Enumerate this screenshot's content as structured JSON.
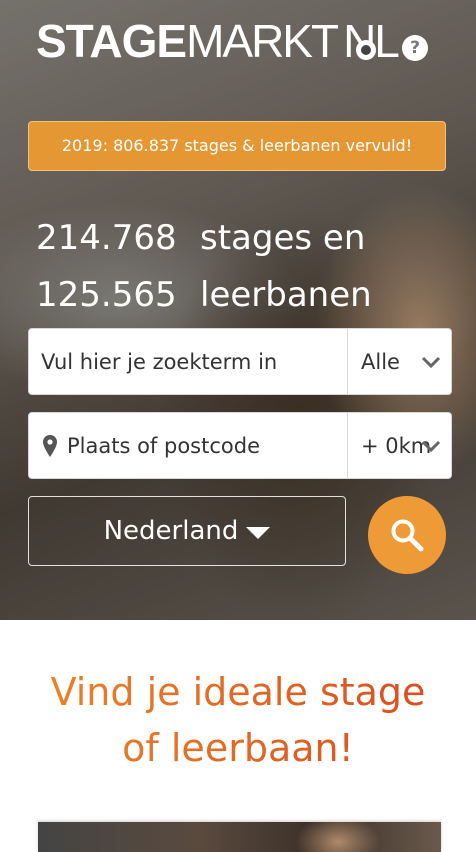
{
  "header": {
    "logo_bold": "STAGE",
    "logo_light": "MARKT",
    "logo_suffix": "NL",
    "help_icon": "help-icon"
  },
  "banner": {
    "text": "2019: 806.837 stages & leerbanen vervuld!"
  },
  "stats": {
    "stages_count": "214.768",
    "stages_label": "stages en",
    "jobs_count": "125.565",
    "jobs_label": "leerbanen"
  },
  "search": {
    "keyword_placeholder": "Vul hier je zoekterm in",
    "category_value": "Alle",
    "location_placeholder": "Plaats of postcode",
    "radius_value": "+ 0km",
    "country_value": "Nederland",
    "search_icon": "search-icon"
  },
  "headline": {
    "line1": "Vind je ideale stage",
    "line2": "of leerbaan!"
  },
  "colors": {
    "accent": "#ee9a37",
    "banner": "#e59733",
    "headline_start": "#ec8a2a",
    "headline_end": "#d9461e"
  }
}
